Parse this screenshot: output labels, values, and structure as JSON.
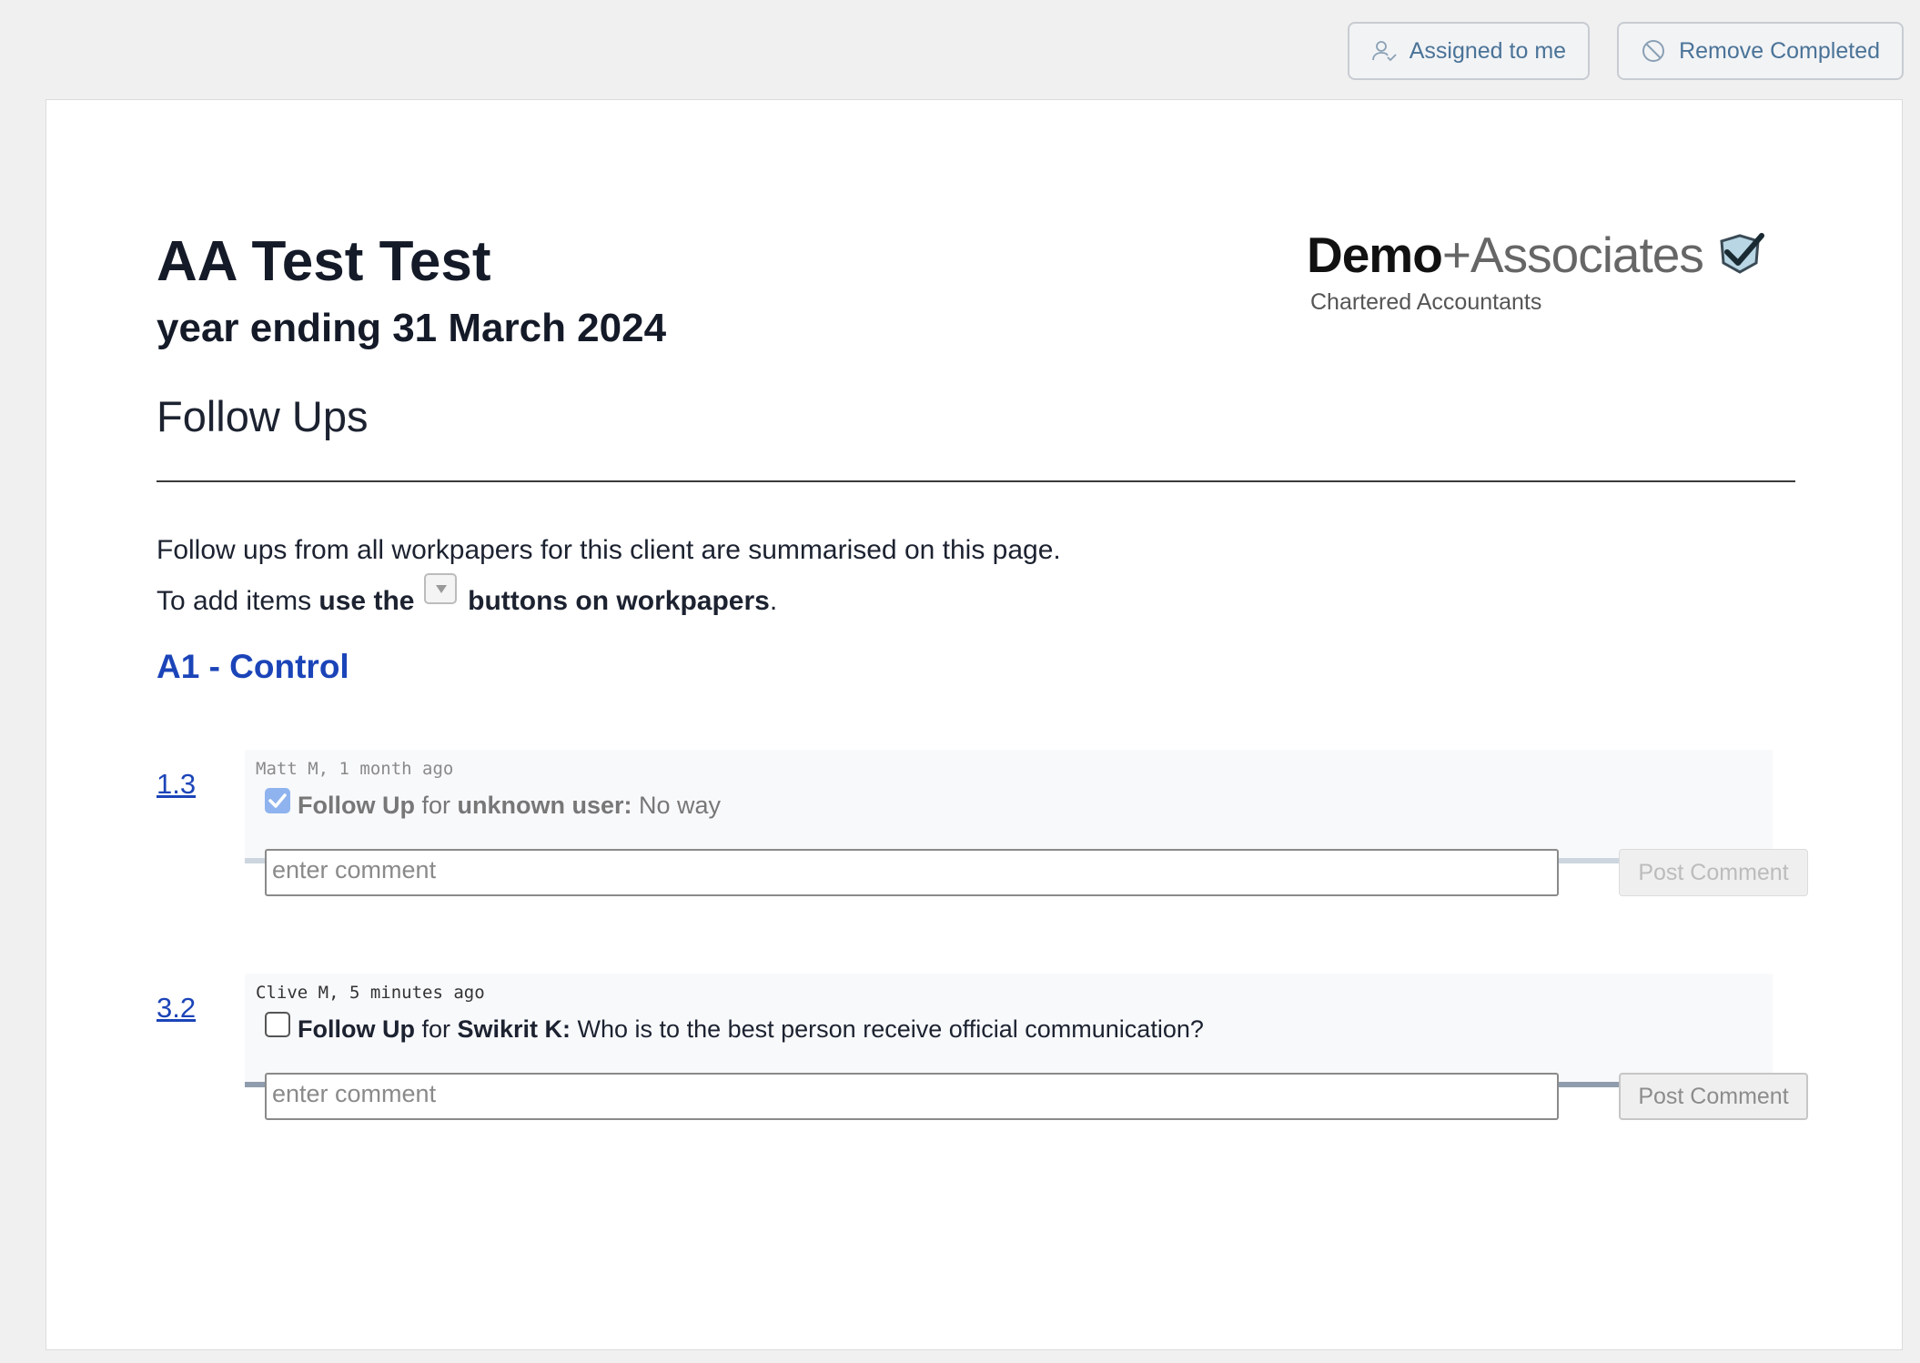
{
  "toolbar": {
    "assigned_label": "Assigned to me",
    "remove_label": "Remove Completed"
  },
  "header": {
    "client_name": "AA Test Test",
    "year_end": "year ending 31 March 2024",
    "page_title": "Follow Ups"
  },
  "logo": {
    "name_bold": "Demo",
    "name_light": "+Associates",
    "subtitle": "Chartered Accountants"
  },
  "intro": {
    "line1": "Follow ups from all workpapers for this client are summarised on this page.",
    "line2_prefix": "To add items ",
    "line2_bold1": "use the",
    "line2_bold2": " buttons on workpapers",
    "line2_suffix": "."
  },
  "section": {
    "title": "A1 - Control"
  },
  "follow_ups": [
    {
      "ref": "1.3",
      "meta": "Matt M, 1 month ago",
      "completed": true,
      "label": "Follow Up",
      "for_word": " for ",
      "user": "unknown user:",
      "message": " No way",
      "comment_placeholder": "enter comment",
      "post_label": "Post Comment"
    },
    {
      "ref": "3.2",
      "meta": "Clive M, 5 minutes ago",
      "completed": false,
      "label": "Follow Up",
      "for_word": " for ",
      "user": "Swikrit K:",
      "message": " Who is to the best person receive official communication?",
      "comment_placeholder": "enter comment",
      "post_label": "Post Comment"
    }
  ],
  "colors": {
    "link": "#1b44b8",
    "toolbar_text": "#4a7398",
    "checkbox_checked": "#8fb3ee"
  }
}
